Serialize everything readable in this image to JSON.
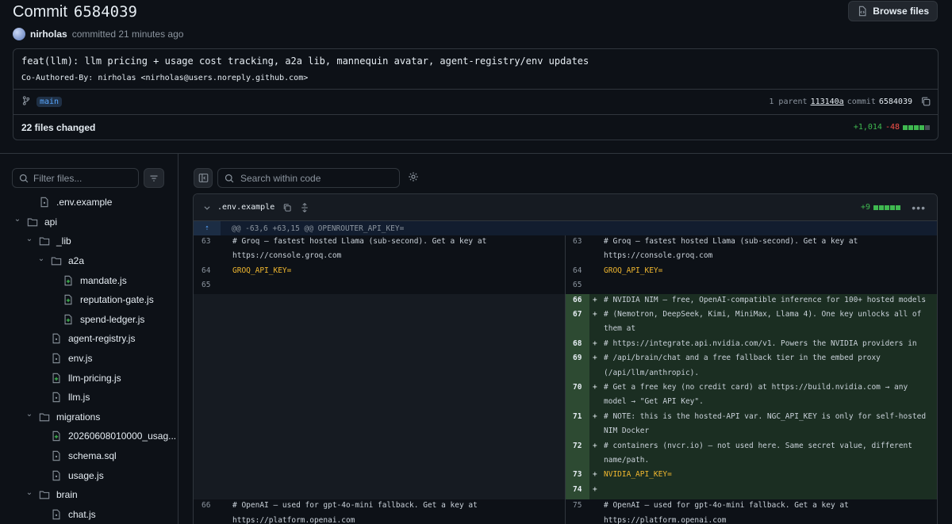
{
  "header": {
    "title_prefix": "Commit",
    "sha": "6584039",
    "browse_label": "Browse files",
    "author": "nirholas",
    "committed_text": "committed 21 minutes ago"
  },
  "message": {
    "title": "feat(llm): llm pricing + usage cost tracking, a2a lib, mannequin avatar, agent-registry/env updates",
    "body": "Co-Authored-By: nirholas <nirholas@users.noreply.github.com>",
    "branch": "main",
    "parent_prefix": "1 parent",
    "parent_sha": "113140a",
    "commit_prefix": "commit",
    "commit_sha": "6584039"
  },
  "summary": {
    "files_changed": "22 files changed",
    "additions": "+1,014",
    "deletions": "-48"
  },
  "sidebar": {
    "filter_placeholder": "Filter files...",
    "tree": [
      {
        "label": ".env.example",
        "type": "file-mod",
        "depth": 1
      },
      {
        "label": "api",
        "type": "folder",
        "depth": 0
      },
      {
        "label": "_lib",
        "type": "folder",
        "depth": 1
      },
      {
        "label": "a2a",
        "type": "folder",
        "depth": 2
      },
      {
        "label": "mandate.js",
        "type": "file-add",
        "depth": 3
      },
      {
        "label": "reputation-gate.js",
        "type": "file-add",
        "depth": 3
      },
      {
        "label": "spend-ledger.js",
        "type": "file-add",
        "depth": 3
      },
      {
        "label": "agent-registry.js",
        "type": "file-mod",
        "depth": 2
      },
      {
        "label": "env.js",
        "type": "file-mod",
        "depth": 2
      },
      {
        "label": "llm-pricing.js",
        "type": "file-add",
        "depth": 2
      },
      {
        "label": "llm.js",
        "type": "file-mod",
        "depth": 2
      },
      {
        "label": "migrations",
        "type": "folder",
        "depth": 1
      },
      {
        "label": "20260608010000_usag...",
        "type": "file-add",
        "depth": 2
      },
      {
        "label": "schema.sql",
        "type": "file-mod",
        "depth": 2
      },
      {
        "label": "usage.js",
        "type": "file-mod",
        "depth": 2
      },
      {
        "label": "brain",
        "type": "folder",
        "depth": 1
      },
      {
        "label": "chat.js",
        "type": "file-mod",
        "depth": 2
      }
    ]
  },
  "toolbar": {
    "search_placeholder": "Search within code"
  },
  "diff": {
    "filename": ".env.example",
    "file_additions": "+9",
    "hunk_header": "@@ -63,6 +63,15 @@ OPENROUTER_API_KEY=",
    "left_lines": [
      {
        "num": "63",
        "text": "# Groq — fastest hosted Llama (sub-second). Get a key at"
      },
      {
        "num": "",
        "text": "https://console.groq.com"
      },
      {
        "num": "64",
        "text": "GROQ_API_KEY="
      },
      {
        "num": "65",
        "text": ""
      }
    ],
    "right_lines": [
      {
        "num": "63",
        "text": "# Groq — fastest hosted Llama (sub-second). Get a key at"
      },
      {
        "num": "",
        "text": "https://console.groq.com"
      },
      {
        "num": "64",
        "text": "GROQ_API_KEY="
      },
      {
        "num": "65",
        "text": ""
      }
    ],
    "added_lines": [
      {
        "num": "66",
        "text": "# NVIDIA NIM — free, OpenAI-compatible inference for 100+ hosted models"
      },
      {
        "num": "67",
        "text": "# (Nemotron, DeepSeek, Kimi, MiniMax, Llama 4). One key unlocks all of"
      },
      {
        "num": "",
        "text": "them at"
      },
      {
        "num": "68",
        "text": "# https://integrate.api.nvidia.com/v1. Powers the NVIDIA providers in"
      },
      {
        "num": "69",
        "text": "# /api/brain/chat and a free fallback tier in the embed proxy"
      },
      {
        "num": "",
        "text": "(/api/llm/anthropic)."
      },
      {
        "num": "70",
        "text": "# Get a free key (no credit card) at https://build.nvidia.com → any"
      },
      {
        "num": "",
        "text": "model → \"Get API Key\"."
      },
      {
        "num": "71",
        "text": "# NOTE: this is the hosted-API var. NGC_API_KEY is only for self-hosted"
      },
      {
        "num": "",
        "text": "NIM Docker"
      },
      {
        "num": "72",
        "text": "# containers (nvcr.io) — not used here. Same secret value, different"
      },
      {
        "num": "",
        "text": "name/path."
      },
      {
        "num": "73",
        "text": "NVIDIA_API_KEY="
      },
      {
        "num": "74",
        "text": ""
      }
    ],
    "after_left": [
      {
        "num": "66",
        "text": "# OpenAI — used for gpt-4o-mini fallback. Get a key at"
      },
      {
        "num": "",
        "text": "https://platform.openai.com"
      }
    ],
    "after_right": [
      {
        "num": "75",
        "text": "# OpenAI — used for gpt-4o-mini fallback. Get a key at"
      },
      {
        "num": "",
        "text": "https://platform.openai.com"
      }
    ]
  },
  "colors": {
    "added": "#3fb950",
    "deleted": "#f85149",
    "accent": "#58a6ff"
  }
}
